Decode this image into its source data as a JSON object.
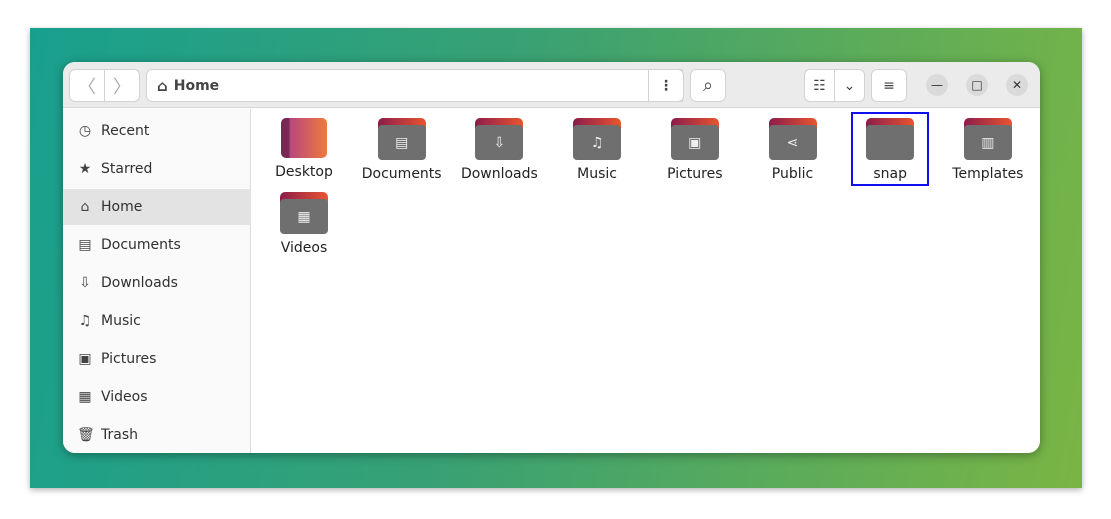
{
  "header": {
    "path": "Home",
    "back": "〈",
    "forward": "〉",
    "more": "⋮",
    "search": "⌕",
    "list_view": "☷",
    "view_options": "⌄",
    "menu": "≡",
    "minimize": "—",
    "maximize": "□",
    "close": "✕"
  },
  "sidebar": {
    "items": [
      {
        "label": "Recent",
        "icon": "◷",
        "selected": false
      },
      {
        "label": "Starred",
        "icon": "★",
        "selected": false
      },
      {
        "label": "Home",
        "icon": "⌂",
        "selected": true
      },
      {
        "label": "Documents",
        "icon": "▤",
        "selected": false
      },
      {
        "label": "Downloads",
        "icon": "⇩",
        "selected": false
      },
      {
        "label": "Music",
        "icon": "♫",
        "selected": false
      },
      {
        "label": "Pictures",
        "icon": "▣",
        "selected": false
      },
      {
        "label": "Videos",
        "icon": "▦",
        "selected": false
      },
      {
        "label": "Trash",
        "icon": "🗑",
        "selected": false
      }
    ]
  },
  "files": [
    {
      "name": "Desktop",
      "glyph": ""
    },
    {
      "name": "Documents",
      "glyph": "▤"
    },
    {
      "name": "Downloads",
      "glyph": "⇩"
    },
    {
      "name": "Music",
      "glyph": "♫"
    },
    {
      "name": "Pictures",
      "glyph": "▣"
    },
    {
      "name": "Public",
      "glyph": "⋖"
    },
    {
      "name": "snap",
      "glyph": ""
    },
    {
      "name": "Templates",
      "glyph": "▥"
    },
    {
      "name": "Videos",
      "glyph": "▦"
    }
  ],
  "selected_file": "snap"
}
